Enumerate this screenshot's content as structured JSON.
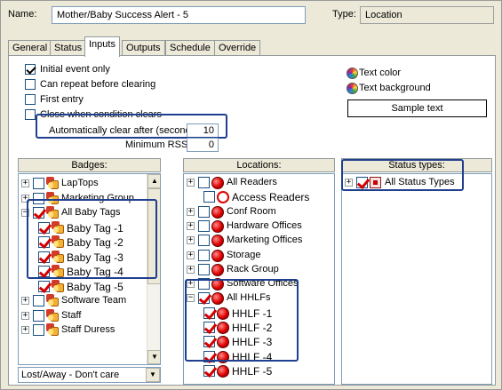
{
  "header": {
    "name_label": "Name:",
    "name_value": "Mother/Baby Success Alert - 5",
    "type_label": "Type:",
    "type_value": "Location"
  },
  "tabs": [
    {
      "label": "General",
      "active": false
    },
    {
      "label": "Status",
      "active": false
    },
    {
      "label": "Inputs",
      "active": true
    },
    {
      "label": "Outputs",
      "active": false
    },
    {
      "label": "Schedule",
      "active": false
    },
    {
      "label": "Override",
      "active": false
    }
  ],
  "options": {
    "initial_event_only": {
      "label": "Initial event only",
      "checked": true
    },
    "can_repeat": {
      "label": "Can repeat before clearing",
      "checked": false
    },
    "first_entry": {
      "label": "First entry",
      "checked": false
    },
    "close_when": {
      "label": "Close when condition clears",
      "checked": false
    },
    "auto_clear_label": "Automatically clear after (seconds):",
    "auto_clear_value": "10",
    "min_rssi_label": "Minimum RSSI:",
    "min_rssi_value": "0"
  },
  "text_style": {
    "text_color_label": "Text color",
    "text_background_label": "Text background",
    "sample_text": "Sample text"
  },
  "badges": {
    "header": "Badges:",
    "items": [
      {
        "label": "LapTops",
        "checked": false,
        "expander": "+"
      },
      {
        "label": "Marketing Group",
        "checked": false,
        "expander": "+"
      },
      {
        "label": "All Baby Tags",
        "checked": true,
        "expander": "-"
      },
      {
        "label": "Baby Tag -1",
        "checked": true
      },
      {
        "label": "Baby Tag -2",
        "checked": true
      },
      {
        "label": "Baby Tag -3",
        "checked": true
      },
      {
        "label": "Baby Tag -4",
        "checked": true
      },
      {
        "label": "Baby Tag -5",
        "checked": true
      },
      {
        "label": "Software Team",
        "checked": false,
        "expander": "+"
      },
      {
        "label": "Staff",
        "checked": false,
        "expander": "+"
      },
      {
        "label": "Staff Duress",
        "checked": false,
        "expander": "+"
      }
    ],
    "filter_value": "Lost/Away - Don't care"
  },
  "locations": {
    "header": "Locations:",
    "items": [
      {
        "label": "All Readers",
        "checked": false,
        "expander": "+"
      },
      {
        "label": "Access Readers",
        "checked": false,
        "icon": "outline"
      },
      {
        "label": "Conf Room",
        "checked": false,
        "expander": "+"
      },
      {
        "label": "Hardware Offices",
        "checked": false,
        "expander": "+"
      },
      {
        "label": "Marketing Offices",
        "checked": false,
        "expander": "+"
      },
      {
        "label": "Storage",
        "checked": false,
        "expander": "+"
      },
      {
        "label": "Rack Group",
        "checked": false,
        "expander": "+"
      },
      {
        "label": "Software Offices",
        "checked": false,
        "expander": "+"
      },
      {
        "label": "All HHLFs",
        "checked": true,
        "expander": "-"
      },
      {
        "label": "HHLF -1",
        "checked": true
      },
      {
        "label": "HHLF -2",
        "checked": true
      },
      {
        "label": "HHLF -3",
        "checked": true
      },
      {
        "label": "HHLF -4",
        "checked": true
      },
      {
        "label": "HHLF -5",
        "checked": true
      }
    ]
  },
  "status_types": {
    "header": "Status types:",
    "items": [
      {
        "label": "All Status Types",
        "checked": true,
        "expander": "+"
      }
    ]
  },
  "colors": {
    "highlight": "#1f3f8f",
    "check_red": "#d40000"
  }
}
